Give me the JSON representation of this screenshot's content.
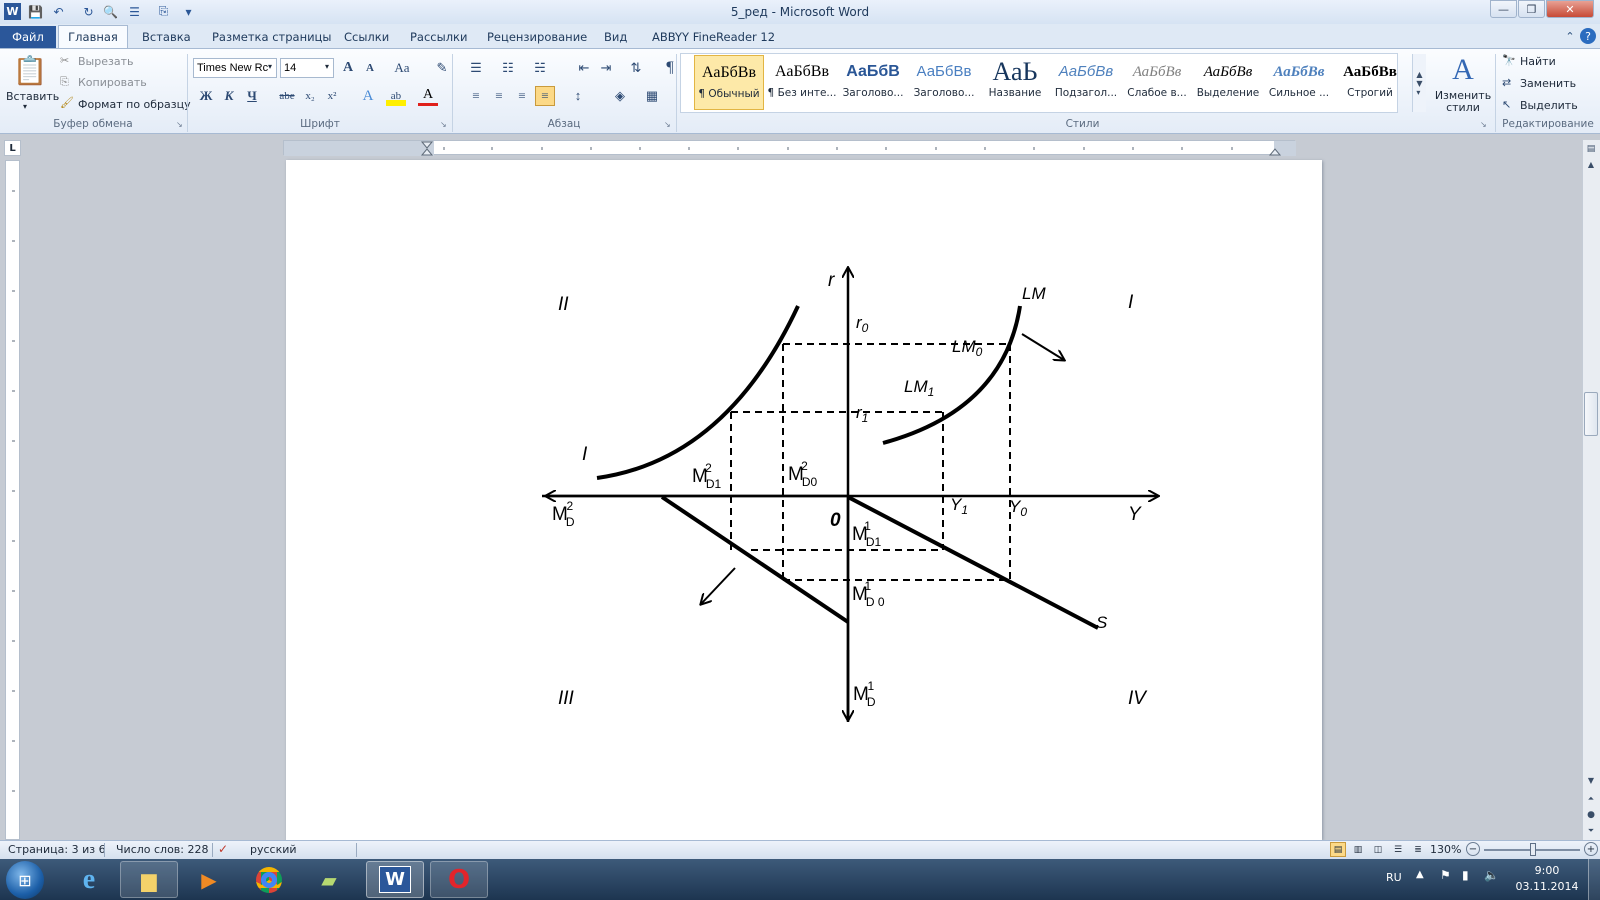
{
  "window": {
    "title": "5_ред - Microsoft Word"
  },
  "tabs": [
    "Файл",
    "Главная",
    "Вставка",
    "Разметка страницы",
    "Ссылки",
    "Рассылки",
    "Рецензирование",
    "Вид",
    "ABBYY FineReader 12"
  ],
  "clipboard": {
    "paste": "Вставить",
    "cut": "Вырезать",
    "copy": "Копировать",
    "format_painter": "Формат по образцу",
    "label": "Буфер обмена"
  },
  "font": {
    "name": "Times New Rc",
    "size": "14",
    "label": "Шрифт",
    "bold": "Ж",
    "italic": "К",
    "underline": "Ч",
    "strike": "abe",
    "sub": "x₂",
    "sup": "x²",
    "grow": "A",
    "shrink": "A",
    "case": "Aa"
  },
  "paragraph": {
    "label": "Абзац",
    "pilcrow": "¶"
  },
  "styles": {
    "label": "Стили",
    "items": [
      {
        "sample": "АаБбВв",
        "name": "¶ Обычный"
      },
      {
        "sample": "АаБбВв",
        "name": "¶ Без инте..."
      },
      {
        "sample": "АаБбВ",
        "name": "Заголово..."
      },
      {
        "sample": "АаБбВв",
        "name": "Заголово..."
      },
      {
        "sample": "АаЬ",
        "name": "Название"
      },
      {
        "sample": "АаБбВв",
        "name": "Подзагол..."
      },
      {
        "sample": "АаБбВв",
        "name": "Слабое в..."
      },
      {
        "sample": "АаБбВв",
        "name": "Выделение"
      },
      {
        "sample": "АаБбВв",
        "name": "Сильное ..."
      },
      {
        "sample": "АаБбВв",
        "name": "Строгий"
      }
    ],
    "change": "Изменить стили"
  },
  "editing": {
    "find": "Найти",
    "replace": "Заменить",
    "select": "Выделить",
    "label": "Редактирование"
  },
  "diagram": {
    "quadrants": [
      "I",
      "II",
      "III",
      "IV"
    ],
    "axes": {
      "y_top": "r",
      "x_right": "Y",
      "origin": "0",
      "x_left": "M",
      "x_left_sub": "D",
      "x_left_sup": "2",
      "y_bottom": "M",
      "y_bottom_sub": "D",
      "y_bottom_sup": "1"
    },
    "labels": {
      "r0": "r",
      "r0_sub": "0",
      "r1": "r",
      "r1_sub": "1",
      "lm": "LM",
      "lm0": "LM",
      "lm0_sub": "0",
      "lm1": "LM",
      "lm1_sub": "1",
      "is_curve": "I",
      "y1": "Y",
      "y1_sub": "1",
      "y0": "Y",
      "y0_sub": "0",
      "s": "S",
      "md2_1": "M",
      "md2_1_sub": "D1",
      "md2_1_sup": "2",
      "md2_0": "M",
      "md2_0_sub": "D0",
      "md2_0_sup": "2",
      "md1_1": "M",
      "md1_1_sub": "D1",
      "md1_1_sup": "1",
      "md1_0": "M",
      "md1_0_sub": "D 0",
      "md1_0_sup": "1"
    }
  },
  "status": {
    "page": "Страница: 3 из 6",
    "words": "Число слов: 228",
    "lang": "русский",
    "zoom": "130%"
  },
  "taskbar": {
    "lang": "RU",
    "time": "9:00",
    "date": "03.11.2014"
  }
}
